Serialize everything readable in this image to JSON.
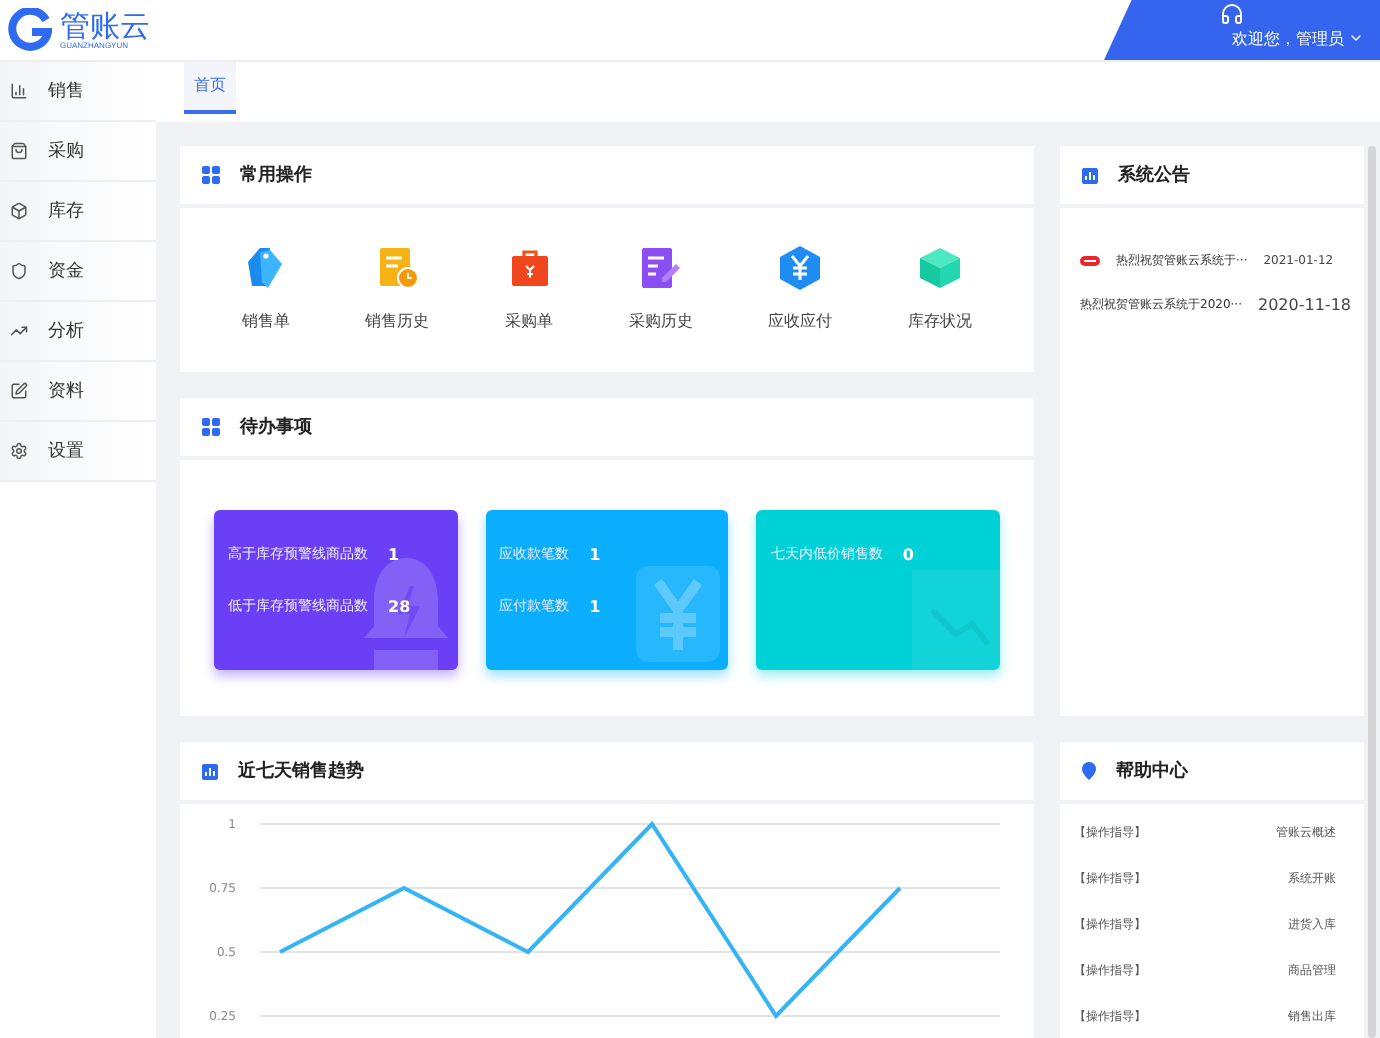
{
  "header": {
    "logo_text": "管账云",
    "logo_subtitle": "GUANZHANGYUN",
    "welcome": "欢迎您，管理员"
  },
  "sidebar": {
    "items": [
      {
        "label": "销售",
        "selected": false
      },
      {
        "label": "采购",
        "selected": false
      },
      {
        "label": "库存",
        "selected": false
      },
      {
        "label": "资金",
        "selected": false
      },
      {
        "label": "分析",
        "selected": false
      },
      {
        "label": "资料",
        "selected": false
      },
      {
        "label": "设置",
        "selected": false
      }
    ]
  },
  "tabs": [
    {
      "label": "首页",
      "selected": true
    }
  ],
  "quick_ops": {
    "title": "常用操作",
    "items": [
      {
        "label": "销售单"
      },
      {
        "label": "销售历史"
      },
      {
        "label": "采购单"
      },
      {
        "label": "采购历史"
      },
      {
        "label": "应收应付"
      },
      {
        "label": "库存状况"
      }
    ]
  },
  "todo": {
    "title": "待办事项",
    "tiles": [
      {
        "color": "#6a3ff5",
        "rows": [
          {
            "label": "高于库存预警线商品数",
            "value": "1"
          },
          {
            "label": "低于库存预警线商品数",
            "value": "28"
          }
        ]
      },
      {
        "color": "#0aaefc",
        "rows": [
          {
            "label": "应收款笔数",
            "value": "1"
          },
          {
            "label": "应付款笔数",
            "value": "1"
          }
        ]
      },
      {
        "color": "#00d1d6",
        "rows": [
          {
            "label": "七天内低价销售数",
            "value": "0"
          }
        ]
      }
    ]
  },
  "sales_trend": {
    "title": "近七天销售趋势",
    "chart_data": {
      "type": "line",
      "values": [
        0.5,
        0.75,
        0.5,
        1,
        0.25,
        0.75
      ],
      "ylim": [
        0.25,
        1
      ],
      "yticks": [
        0.25,
        0.5,
        0.75,
        1
      ]
    }
  },
  "notices": {
    "title": "系统公告",
    "items": [
      {
        "text": "热烈祝贺管账云系统于···",
        "date": "2021-01-12",
        "hot": true
      },
      {
        "text": "热烈祝贺管账云系统于2020···",
        "date": "2020-11-18",
        "hot": false
      }
    ]
  },
  "help": {
    "title": "帮助中心",
    "items": [
      {
        "tag": "【操作指导】",
        "title": "管账云概述"
      },
      {
        "tag": "【操作指导】",
        "title": "系统开账"
      },
      {
        "tag": "【操作指导】",
        "title": "进货入库"
      },
      {
        "tag": "【操作指导】",
        "title": "商品管理"
      },
      {
        "tag": "【操作指导】",
        "title": "销售出库"
      }
    ]
  }
}
